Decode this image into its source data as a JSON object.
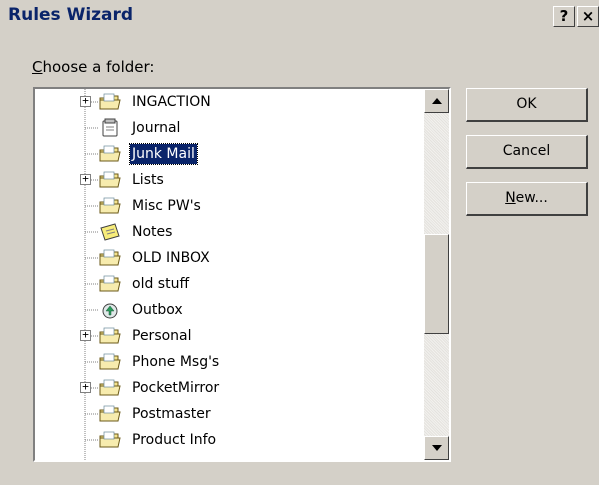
{
  "window": {
    "title": "Rules Wizard",
    "help_label": "?",
    "close_label": "×"
  },
  "prompt": {
    "mnemonic": "C",
    "rest": "hoose a folder:"
  },
  "buttons": {
    "ok": "OK",
    "cancel": "Cancel",
    "new_mnemonic": "N",
    "new_rest": "ew..."
  },
  "folders": [
    {
      "label": "INGACTION",
      "expandable": true,
      "icon": "folder-icon",
      "selected": false
    },
    {
      "label": "Journal",
      "expandable": false,
      "icon": "journal-icon",
      "selected": false
    },
    {
      "label": "Junk Mail",
      "expandable": false,
      "icon": "folder-icon",
      "selected": true
    },
    {
      "label": "Lists",
      "expandable": true,
      "icon": "folder-icon",
      "selected": false
    },
    {
      "label": "Misc PW's",
      "expandable": false,
      "icon": "folder-icon",
      "selected": false
    },
    {
      "label": "Notes",
      "expandable": false,
      "icon": "notes-icon",
      "selected": false
    },
    {
      "label": "OLD INBOX",
      "expandable": false,
      "icon": "folder-icon",
      "selected": false
    },
    {
      "label": "old stuff",
      "expandable": false,
      "icon": "folder-icon",
      "selected": false
    },
    {
      "label": "Outbox",
      "expandable": false,
      "icon": "outbox-icon",
      "selected": false
    },
    {
      "label": "Personal",
      "expandable": true,
      "icon": "folder-icon",
      "selected": false
    },
    {
      "label": "Phone Msg's",
      "expandable": false,
      "icon": "folder-icon",
      "selected": false
    },
    {
      "label": "PocketMirror",
      "expandable": true,
      "icon": "folder-icon",
      "selected": false
    },
    {
      "label": "Postmaster",
      "expandable": false,
      "icon": "folder-icon",
      "selected": false
    },
    {
      "label": "Product Info",
      "expandable": false,
      "icon": "folder-icon",
      "selected": false
    }
  ],
  "colors": {
    "selection": "#0a246a",
    "folder_fill": "#f4e38c",
    "dialog_face": "#d4d0c8"
  }
}
